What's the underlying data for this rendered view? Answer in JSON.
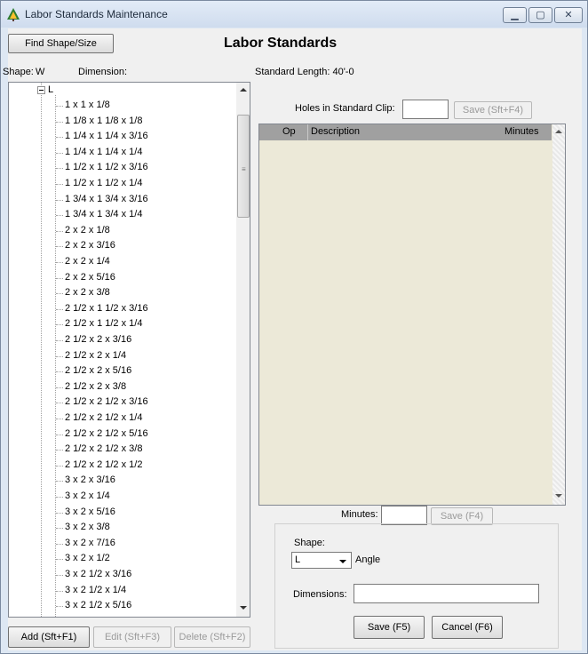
{
  "window": {
    "title": "Labor Standards Maintenance",
    "icon": "tree-app-icon"
  },
  "header": {
    "find_button": "Find Shape/Size",
    "heading": "Labor Standards"
  },
  "shape_info": {
    "shape_label": "Shape:",
    "shape_value": "W",
    "dimension_label": "Dimension:",
    "standard_length": "Standard Length:  40'-0"
  },
  "holes": {
    "label": "Holes in Standard Clip:",
    "value": "",
    "save_button": "Save (Sft+F4)"
  },
  "grid": {
    "columns": [
      "Op",
      "Description",
      "Minutes"
    ],
    "rows": []
  },
  "minutes": {
    "label": "Minutes:",
    "value": "",
    "save_button": "Save (F4)"
  },
  "tree": {
    "root": "L",
    "items": [
      "1 x 1 x 1/8",
      "1 1/8 x 1 1/8 x 1/8",
      "1 1/4 x 1 1/4 x 3/16",
      "1 1/4 x 1 1/4 x 1/4",
      "1 1/2 x 1 1/2 x 3/16",
      "1 1/2 x 1 1/2 x 1/4",
      "1 3/4 x 1 3/4 x 3/16",
      "1 3/4 x 1 3/4 x 1/4",
      "2 x 2 x 1/8",
      "2 x 2 x 3/16",
      "2 x 2 x 1/4",
      "2 x 2 x 5/16",
      "2 x 2 x 3/8",
      "2 1/2 x 1 1/2 x 3/16",
      "2 1/2 x 1 1/2 x 1/4",
      "2 1/2 x 2 x 3/16",
      "2 1/2 x 2 x 1/4",
      "2 1/2 x 2 x 5/16",
      "2 1/2 x 2 x 3/8",
      "2 1/2 x 2 1/2 x 3/16",
      "2 1/2 x 2 1/2 x 1/4",
      "2 1/2 x 2 1/2 x 5/16",
      "2 1/2 x 2 1/2 x 3/8",
      "2 1/2 x 2 1/2 x 1/2",
      "3 x 2 x 3/16",
      "3 x 2 x 1/4",
      "3 x 2 x 5/16",
      "3 x 2 x 3/8",
      "3 x 2 x 7/16",
      "3 x 2 x 1/2",
      "3 x 2 1/2 x 3/16",
      "3 x 2 1/2 x 1/4",
      "3 x 2 1/2 x 5/16"
    ]
  },
  "bottom_buttons": {
    "add": "Add (Sft+F1)",
    "edit": "Edit (Sft+F3)",
    "delete": "Delete (Sft+F2)"
  },
  "edit_group": {
    "shape_label": "Shape:",
    "shape_value": "L",
    "shape_desc": "Angle",
    "dimensions_label": "Dimensions:",
    "dimensions_value": "",
    "save_button": "Save (F5)",
    "cancel_button": "Cancel (F6)"
  },
  "colors": {
    "grid_background": "#ece9d8",
    "grid_header": "#a0a0a0",
    "disabled_text": "#9a9a9a"
  }
}
